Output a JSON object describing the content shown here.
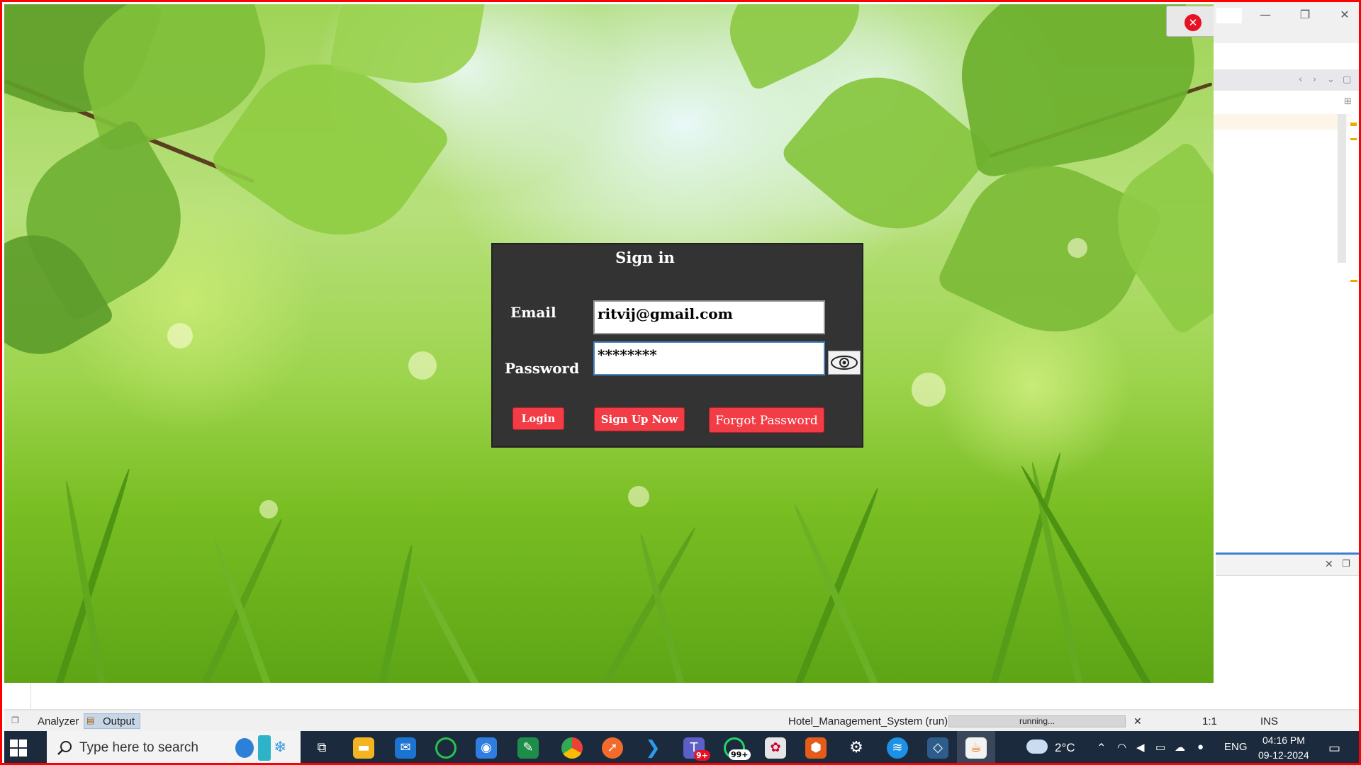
{
  "app": {
    "dialog_title": "Sign in",
    "email_label": "Email",
    "email_value": "ritvij@gmail.com",
    "password_label": "Password",
    "password_value": "********",
    "login_button": "Login",
    "signup_button": "Sign Up Now",
    "forgot_button": "Forgot Password",
    "close_glyph": "✕"
  },
  "statusbar": {
    "analyzer": "Analyzer",
    "output": "Output",
    "run_name": "Hotel_Management_System (run)",
    "progress_text": "running...",
    "cursor_pos": "1:1",
    "mode": "INS",
    "close_glyph": "✕"
  },
  "taskbar": {
    "search_placeholder": "Type here to search",
    "teams_badge": "9+",
    "whatsapp_badge": "99+",
    "weather": "2°C",
    "language": "ENG",
    "time": "04:16 PM",
    "date": "09-12-2024"
  },
  "icons": {
    "taskbar": [
      "windows-start-icon",
      "search-icon",
      "copilot-icon",
      "widgets-icon",
      "task-view-icon",
      "file-explorer-icon",
      "mail-icon",
      "sync-icon",
      "edge-icon",
      "excel-icon",
      "chrome-icon",
      "postman-icon",
      "vscode-icon",
      "teams-icon",
      "whatsapp-icon",
      "paint-icon",
      "office-icon",
      "settings-icon",
      "docker-icon",
      "netbeans-icon",
      "java-icon"
    ]
  },
  "colors": {
    "dialog_bg": "#333333",
    "button_red": "#f23c46",
    "taskbar_bg": "#1c2a3d",
    "border_red": "#ff0000"
  }
}
